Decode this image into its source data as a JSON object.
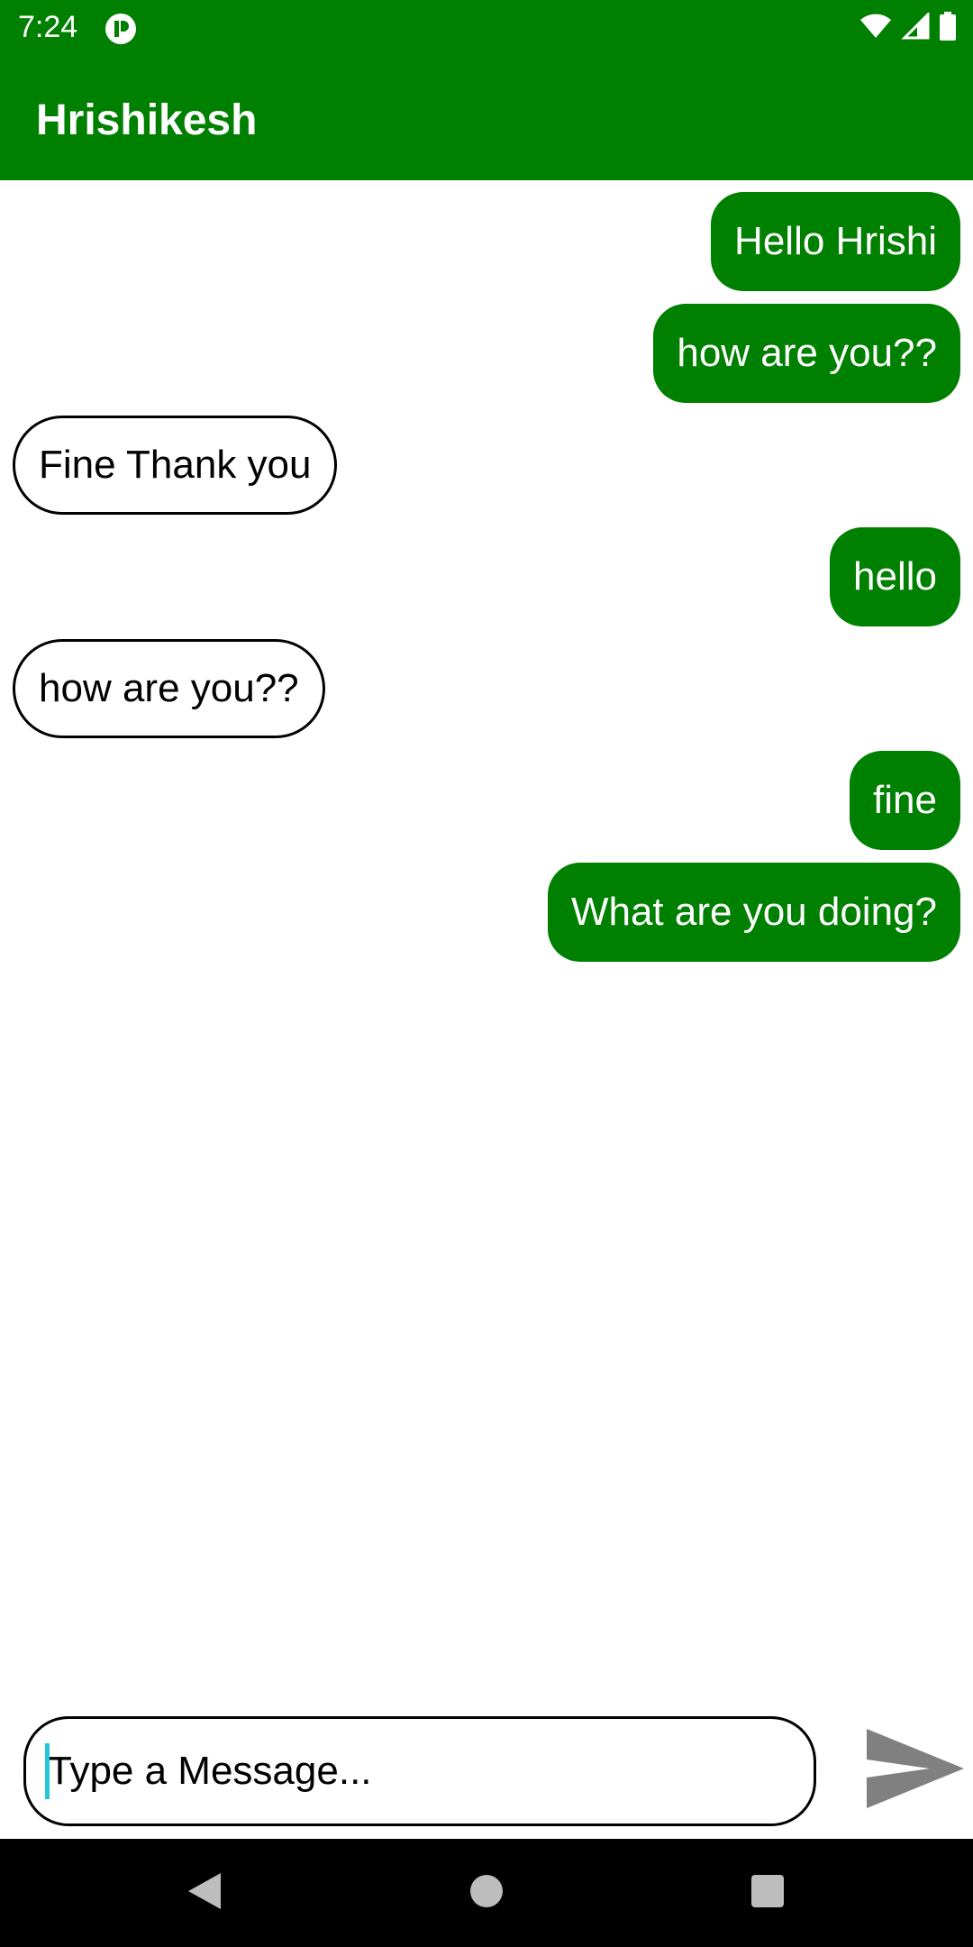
{
  "status_bar": {
    "time": "7:24",
    "icons": [
      "app-notification-icon",
      "wifi-icon",
      "signal-icon",
      "battery-icon"
    ]
  },
  "app_bar": {
    "title": "Hrishikesh",
    "color": "#008000"
  },
  "messages": [
    {
      "text": "Hello Hrishi",
      "direction": "sent"
    },
    {
      "text": "how are you??",
      "direction": "sent"
    },
    {
      "text": "Fine Thank you",
      "direction": "received"
    },
    {
      "text": "hello",
      "direction": "sent"
    },
    {
      "text": "how are you??",
      "direction": "received"
    },
    {
      "text": "fine",
      "direction": "sent"
    },
    {
      "text": "What are you doing?",
      "direction": "sent"
    }
  ],
  "composer": {
    "placeholder": "Type a Message...",
    "value": "",
    "send_icon": "send-icon"
  },
  "nav_bar": {
    "buttons": [
      "back-icon",
      "home-icon",
      "recents-icon"
    ]
  },
  "colors": {
    "accent": "#008000",
    "sent_bubble": "#008000",
    "received_border": "#000000",
    "caret": "#26c6da",
    "send_icon": "#808080"
  }
}
